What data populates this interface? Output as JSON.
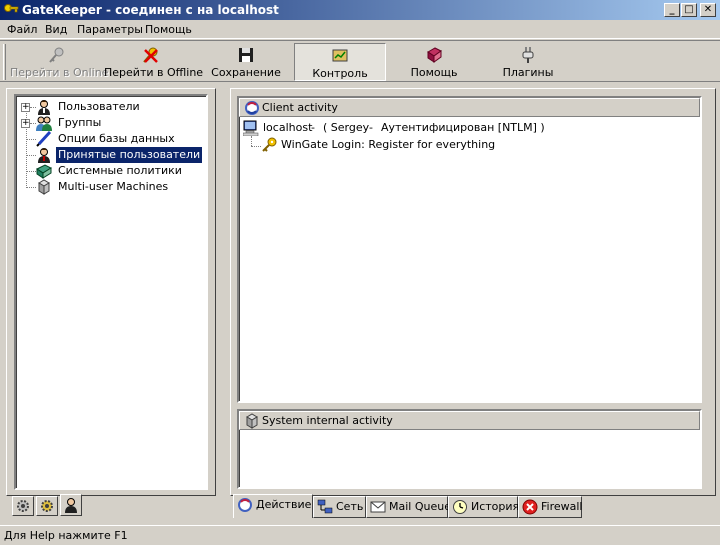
{
  "window": {
    "title": "GateKeeper - соединен с на localhost",
    "minimize": "_",
    "maximize": "□",
    "close": "✕"
  },
  "menu": [
    "Файл",
    "Вид",
    "Параметры",
    "Помощь"
  ],
  "toolbar": {
    "go_online": "Перейти в Online",
    "go_offline": "Перейти в Offline",
    "save": "Сохранение",
    "control": "Контроль",
    "help": "Помощь",
    "plugins": "Плагины"
  },
  "tree": {
    "items": [
      {
        "label": "Пользователи",
        "icon": "users-icon",
        "expandable": true
      },
      {
        "label": "Группы",
        "icon": "groups-icon",
        "expandable": true
      },
      {
        "label": "Опции базы данных",
        "icon": "database-options-icon",
        "expandable": false
      },
      {
        "label": "Принятые пользователи",
        "icon": "accepted-users-icon",
        "expandable": false,
        "selected": true
      },
      {
        "label": "Системные политики",
        "icon": "system-policies-icon",
        "expandable": false
      },
      {
        "label": "Multi-user Machines",
        "icon": "multi-user-machines-icon",
        "expandable": false
      }
    ]
  },
  "client_activity": {
    "header": "Client activity",
    "host": "localhost",
    "sep1": "-",
    "user": "( Sergey",
    "sep2": "-",
    "status": "Аутентифицирован [NTLM] )",
    "child": "WinGate Login: Register for everything"
  },
  "system_activity": {
    "header": "System internal activity"
  },
  "bottom_tabs": [
    "Действие",
    "Сеть",
    "Mail Queue",
    "История",
    "Firewall"
  ],
  "status": "Для Help нажмите F1",
  "colors": {
    "titlebar_start": "#0a246a",
    "titlebar_end": "#a6caf0",
    "face": "#d4d0c8",
    "selection": "#0a246a"
  }
}
